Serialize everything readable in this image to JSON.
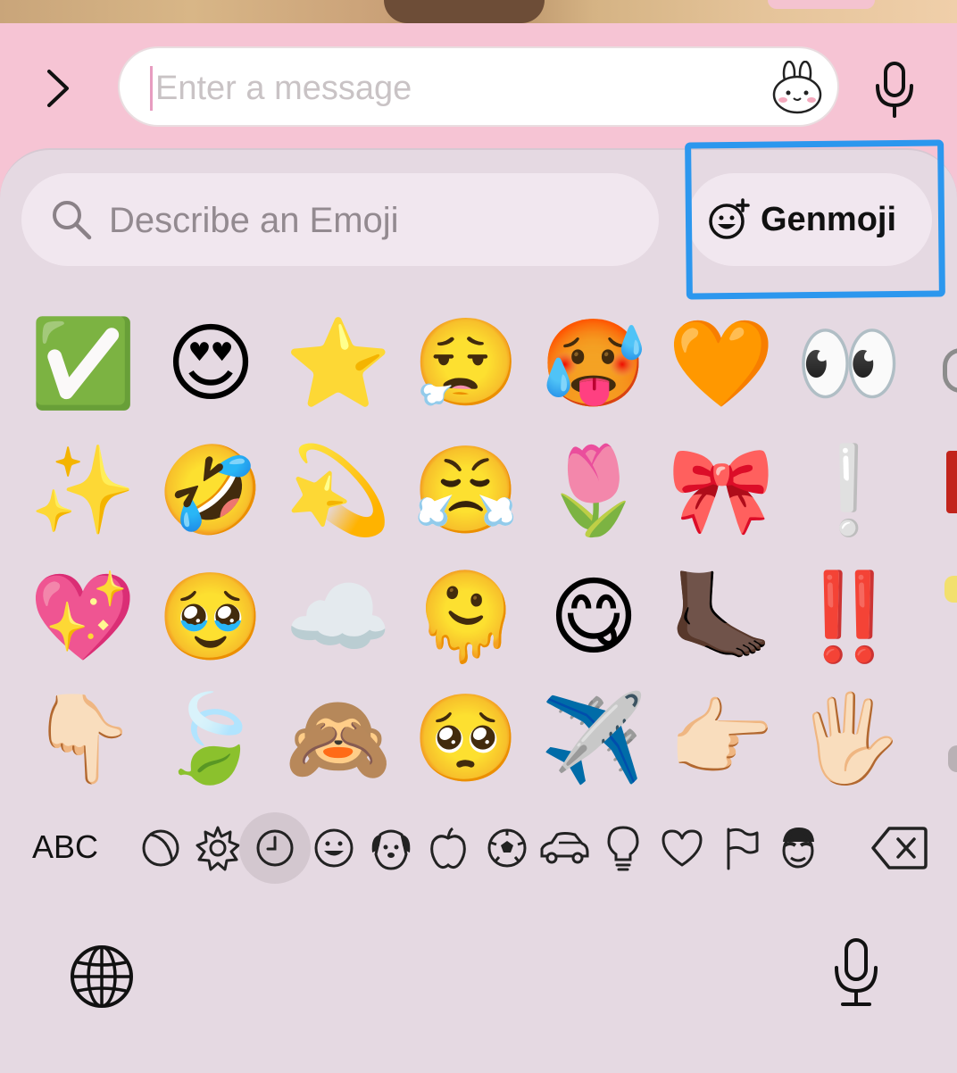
{
  "message_bar": {
    "placeholder": "Enter a message",
    "expand_icon": "chevron-right-icon",
    "sticker_icon": "bunny-sticker-icon",
    "mic_icon": "microphone-icon"
  },
  "emoji_search": {
    "placeholder": "Describe an Emoji",
    "icon": "magnifier-icon"
  },
  "genmoji_button": {
    "label": "Genmoji",
    "icon": "genmoji-smiley-plus-icon"
  },
  "annotation": {
    "color": "#2c97ee"
  },
  "emoji_grid": {
    "rows": [
      [
        "✅",
        "😍",
        "⭐",
        "😮‍💨",
        "🥵",
        "🧡",
        "👀"
      ],
      [
        "✨",
        "🤣",
        "💫",
        "😤",
        "🌷",
        "🎀",
        "❕"
      ],
      [
        "💖",
        "🥹",
        "☁️",
        "🫠",
        "😋",
        "🦶🏿",
        "‼️"
      ],
      [
        "👇🏻",
        "🍃",
        "🙈",
        "🥺",
        "✈️",
        "👉🏻",
        "🖐🏻"
      ]
    ]
  },
  "category_bar": {
    "abc_label": "ABC",
    "categories": [
      {
        "name": "moon-icon",
        "active": false
      },
      {
        "name": "sparkle-flower-icon",
        "active": false
      },
      {
        "name": "clock-icon",
        "active": true
      },
      {
        "name": "smiley-icon",
        "active": false
      },
      {
        "name": "dog-icon",
        "active": false
      },
      {
        "name": "apple-icon",
        "active": false
      },
      {
        "name": "soccer-ball-icon",
        "active": false
      },
      {
        "name": "car-icon",
        "active": false
      },
      {
        "name": "lightbulb-icon",
        "active": false
      },
      {
        "name": "heart-icon",
        "active": false
      },
      {
        "name": "flag-icon",
        "active": false
      },
      {
        "name": "memoji-icon",
        "active": false
      }
    ],
    "delete_icon": "delete-backspace-icon"
  },
  "keyboard_footer": {
    "globe_icon": "globe-icon",
    "dictation_icon": "microphone-icon"
  },
  "colors": {
    "background_pink": "#f6c4d4",
    "panel": "#e5d9e2",
    "search_bg": "#f1e7ef"
  }
}
